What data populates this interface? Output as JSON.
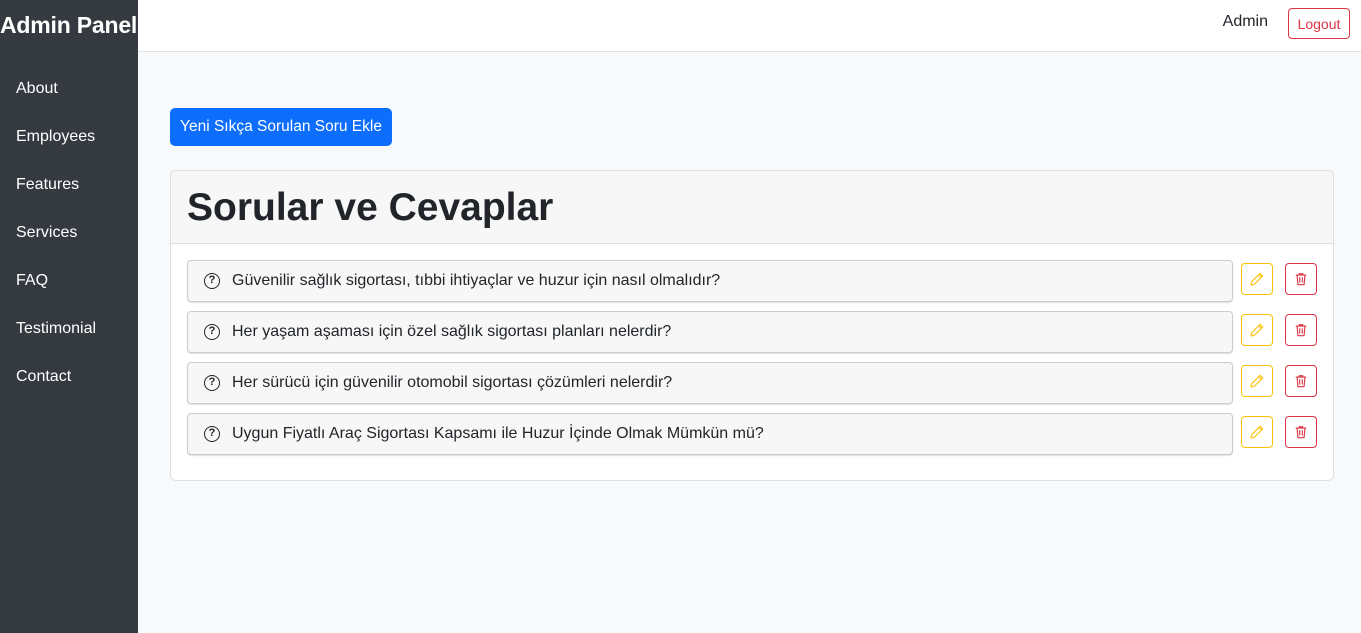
{
  "sidebar": {
    "brand": "Admin Panel",
    "items": [
      {
        "label": "About"
      },
      {
        "label": "Employees"
      },
      {
        "label": "Features"
      },
      {
        "label": "Services"
      },
      {
        "label": "FAQ"
      },
      {
        "label": "Testimonial"
      },
      {
        "label": "Contact"
      }
    ]
  },
  "topbar": {
    "user": "Admin",
    "logout_label": "Logout"
  },
  "main": {
    "add_button_label": "Yeni Sıkça Sorulan Soru Ekle",
    "card_title": "Sorular ve Cevaplar",
    "faq_items": [
      {
        "question": "Güvenilir sağlık sigortası, tıbbi ihtiyaçlar ve huzur için nasıl olmalıdır?"
      },
      {
        "question": "Her yaşam aşaması için özel sağlık sigortası planları nelerdir?"
      },
      {
        "question": "Her sürücü için güvenilir otomobil sigortası çözümleri nelerdir?"
      },
      {
        "question": "Uygun Fiyatlı Araç Sigortası Kapsamı ile Huzur İçinde Olmak Mümkün mü?"
      }
    ]
  },
  "icons": {
    "question": "question-circle-icon",
    "edit": "pencil-icon",
    "delete": "trash-icon"
  },
  "colors": {
    "sidebar_bg": "#343a40",
    "primary": "#0d6efd",
    "warning": "#ffc107",
    "danger": "#dc3545"
  }
}
